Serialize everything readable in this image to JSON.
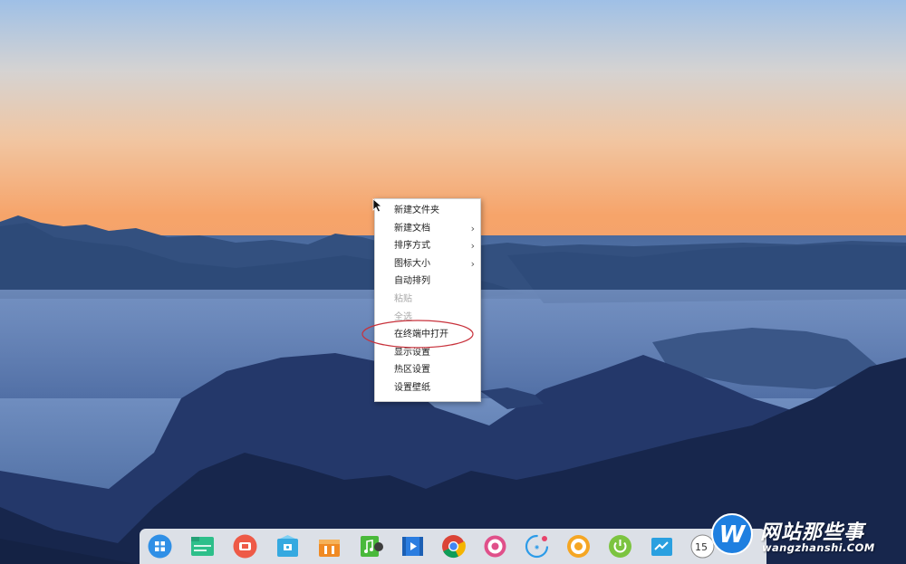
{
  "desktop": {
    "wallpaper": "mountain-sunset-wallpaper"
  },
  "context_menu": {
    "items": [
      {
        "label": "新建文件夹",
        "submenu": false,
        "disabled": false
      },
      {
        "label": "新建文档",
        "submenu": true,
        "disabled": false
      },
      {
        "label": "排序方式",
        "submenu": true,
        "disabled": false
      },
      {
        "label": "图标大小",
        "submenu": true,
        "disabled": false
      },
      {
        "label": "自动排列",
        "submenu": false,
        "disabled": false
      },
      {
        "label": "粘贴",
        "submenu": false,
        "disabled": true
      },
      {
        "label": "全选",
        "submenu": false,
        "disabled": true
      },
      {
        "label": "在终端中打开",
        "submenu": false,
        "disabled": false,
        "highlighted": true
      },
      {
        "label": "显示设置",
        "submenu": false,
        "disabled": false
      },
      {
        "label": "热区设置",
        "submenu": false,
        "disabled": false
      },
      {
        "label": "设置壁纸",
        "submenu": false,
        "disabled": false
      }
    ],
    "submenu_arrow": "›",
    "highlight_color": "#c8323c"
  },
  "dock": {
    "icons": [
      {
        "name": "launcher-icon",
        "color": "#2f8fe6"
      },
      {
        "name": "file-manager-icon",
        "color": "#2dbf8a"
      },
      {
        "name": "screen-recorder-icon",
        "color": "#ee5a47"
      },
      {
        "name": "app-store-icon",
        "color": "#35a9e0"
      },
      {
        "name": "shopping-bag-icon",
        "color": "#f08a24"
      },
      {
        "name": "music-icon",
        "color": "#49b93b"
      },
      {
        "name": "video-player-icon",
        "color": "#2b7de0"
      },
      {
        "name": "chrome-icon",
        "color": "#db4437"
      },
      {
        "name": "settings-icon",
        "color": "#e0508a"
      },
      {
        "name": "system-monitor-icon",
        "color": "#2c9be8"
      },
      {
        "name": "screenshot-icon",
        "color": "#f5a623"
      },
      {
        "name": "power-icon",
        "color": "#7cc440"
      },
      {
        "name": "task-manager-icon",
        "color": "#2aa0e0"
      },
      {
        "name": "clock-icon",
        "color": "#555555"
      }
    ],
    "clock_text": "15"
  },
  "watermark": {
    "badge_letter": "W",
    "title": "网站那些事",
    "url": "wangzhanshi.COM",
    "badge_color": "#1e7fe0"
  }
}
